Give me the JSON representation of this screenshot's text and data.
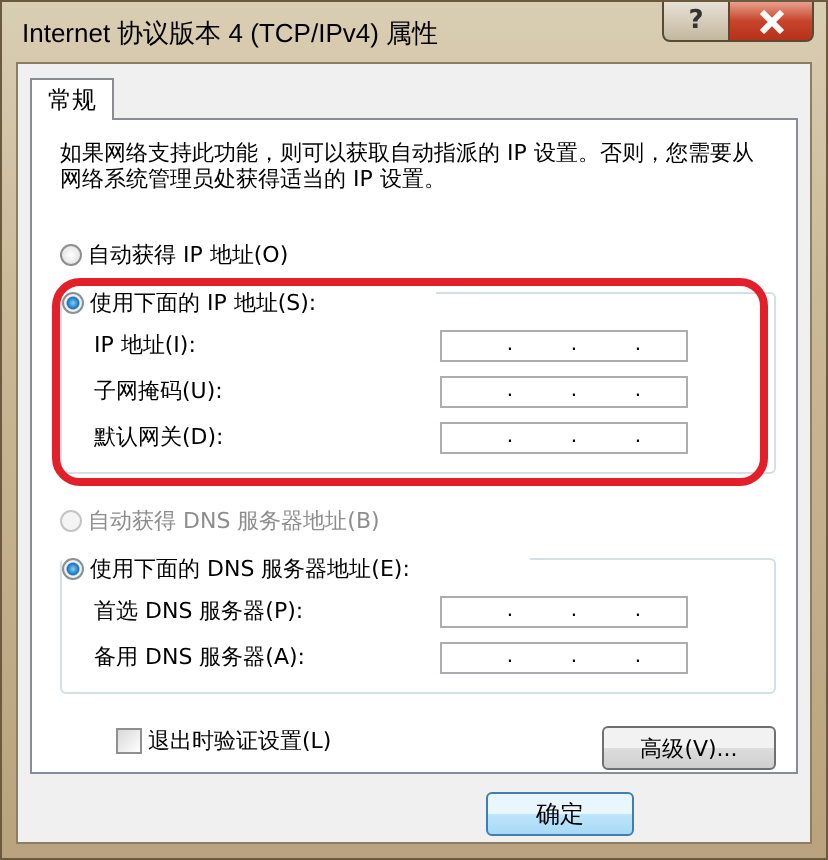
{
  "window": {
    "title": "Internet 协议版本 4 (TCP/IPv4) 属性",
    "help_button": "?"
  },
  "tabs": [
    {
      "label": "常规",
      "selected": true
    }
  ],
  "description": "如果网络支持此功能，则可以获取自动指派的 IP 设置。否则，您需要从网络系统管理员处获得适当的 IP 设置。",
  "ip_mode": [
    {
      "label": "自动获得 IP 地址(O)",
      "selected": false,
      "disabled": false
    },
    {
      "label": "使用下面的 IP 地址(S):",
      "selected": true,
      "disabled": false
    }
  ],
  "ip_fields": [
    {
      "label": "IP 地址(I):",
      "separators": [
        ".",
        ".",
        "."
      ]
    },
    {
      "label": "子网掩码(U):",
      "separators": [
        ".",
        ".",
        "."
      ]
    },
    {
      "label": "默认网关(D):",
      "separators": [
        ".",
        ".",
        "."
      ]
    }
  ],
  "dns_mode": [
    {
      "label": "自动获得 DNS 服务器地址(B)",
      "selected": false,
      "disabled": true
    },
    {
      "label": "使用下面的 DNS 服务器地址(E):",
      "selected": true,
      "disabled": false
    }
  ],
  "dns_fields": [
    {
      "label": "首选 DNS 服务器(P):",
      "separators": [
        ".",
        ".",
        "."
      ]
    },
    {
      "label": "备用 DNS 服务器(A):",
      "separators": [
        ".",
        ".",
        "."
      ]
    }
  ],
  "validate_checkbox": {
    "label": "退出时验证设置(L)",
    "checked": false
  },
  "buttons": [
    {
      "label": "高级(V)...",
      "kind": "advanced"
    },
    {
      "label": "确定",
      "kind": "ok"
    }
  ]
}
